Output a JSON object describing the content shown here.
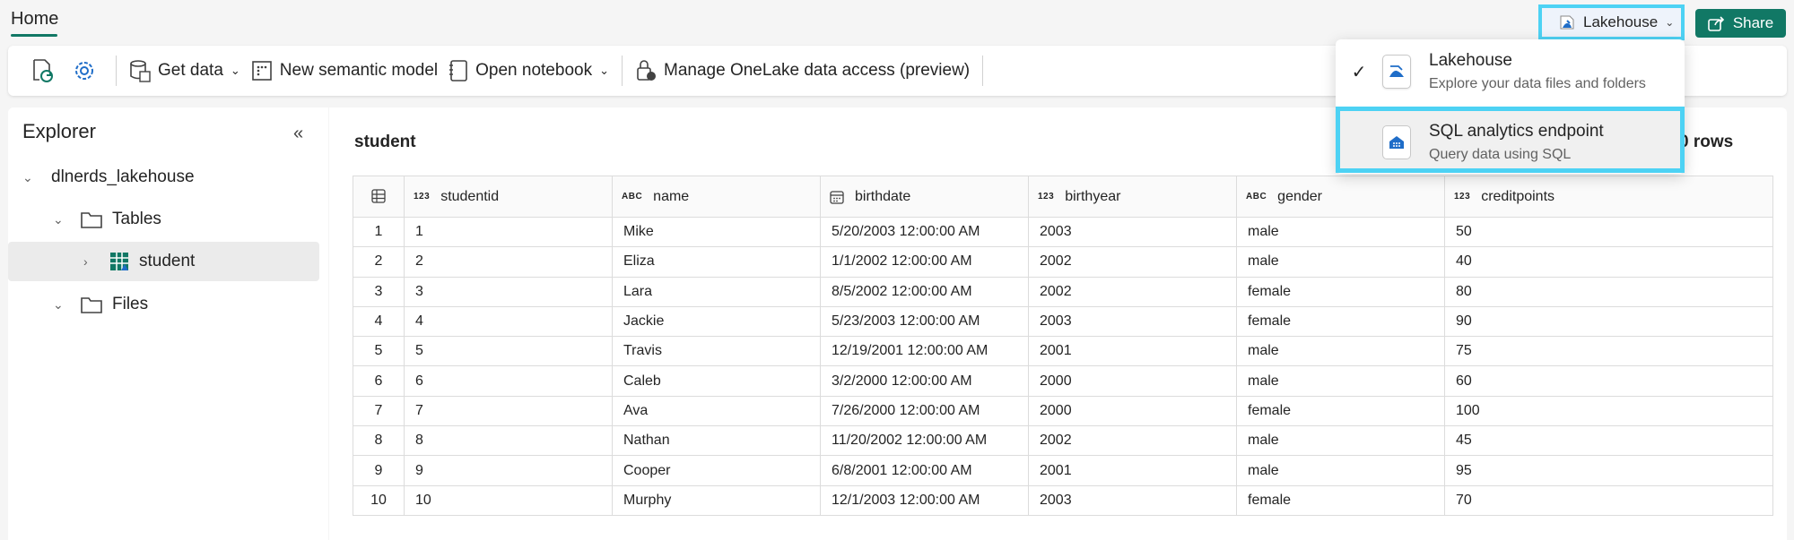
{
  "topbar": {
    "home_tab": "Home",
    "switcher_label": "Lakehouse",
    "share_label": "Share"
  },
  "ribbon": {
    "get_data": "Get data",
    "new_semantic_model": "New semantic model",
    "open_notebook": "Open notebook",
    "manage_access": "Manage OneLake data access (preview)"
  },
  "explorer": {
    "title": "Explorer",
    "lakehouse_name": "dlnerds_lakehouse",
    "tables_label": "Tables",
    "table_item": "student",
    "files_label": "Files"
  },
  "main": {
    "table_title": "student",
    "showing_text": "ng 10 rows",
    "columns": [
      {
        "type": "123",
        "name": "studentid"
      },
      {
        "type": "ABC",
        "name": "name"
      },
      {
        "type": "date",
        "name": "birthdate"
      },
      {
        "type": "123",
        "name": "birthyear"
      },
      {
        "type": "ABC",
        "name": "gender"
      },
      {
        "type": "123",
        "name": "creditpoints"
      }
    ],
    "rows": [
      [
        "1",
        "1",
        "Mike",
        "5/20/2003 12:00:00 AM",
        "2003",
        "male",
        "50"
      ],
      [
        "2",
        "2",
        "Eliza",
        "1/1/2002 12:00:00 AM",
        "2002",
        "male",
        "40"
      ],
      [
        "3",
        "3",
        "Lara",
        "8/5/2002 12:00:00 AM",
        "2002",
        "female",
        "80"
      ],
      [
        "4",
        "4",
        "Jackie",
        "5/23/2003 12:00:00 AM",
        "2003",
        "female",
        "90"
      ],
      [
        "5",
        "5",
        "Travis",
        "12/19/2001 12:00:00 AM",
        "2001",
        "male",
        "75"
      ],
      [
        "6",
        "6",
        "Caleb",
        "3/2/2000 12:00:00 AM",
        "2000",
        "male",
        "60"
      ],
      [
        "7",
        "7",
        "Ava",
        "7/26/2000 12:00:00 AM",
        "2000",
        "female",
        "100"
      ],
      [
        "8",
        "8",
        "Nathan",
        "11/20/2002 12:00:00 AM",
        "2002",
        "male",
        "45"
      ],
      [
        "9",
        "9",
        "Cooper",
        "6/8/2001 12:00:00 AM",
        "2001",
        "male",
        "95"
      ],
      [
        "10",
        "10",
        "Murphy",
        "12/1/2003 12:00:00 AM",
        "2003",
        "female",
        "70"
      ]
    ]
  },
  "dropdown": {
    "items": [
      {
        "title": "Lakehouse",
        "subtitle": "Explore your data files and folders",
        "checked": true
      },
      {
        "title": "SQL analytics endpoint",
        "subtitle": "Query data using SQL",
        "checked": false
      }
    ]
  },
  "colors": {
    "accent": "#117865",
    "highlight": "#4dd2f4"
  }
}
